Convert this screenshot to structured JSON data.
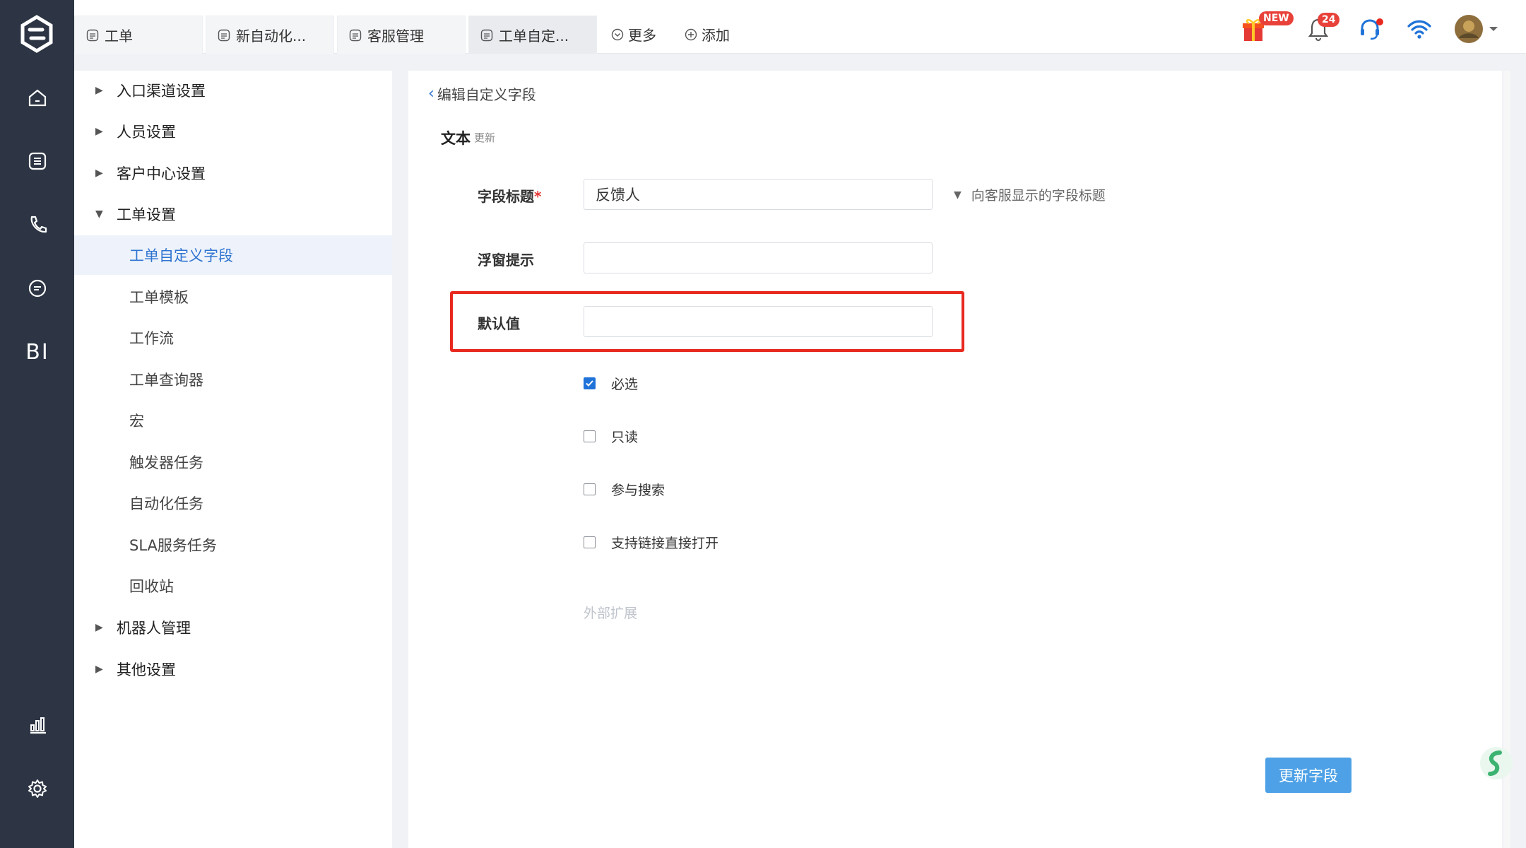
{
  "tabs": [
    {
      "label": "工单"
    },
    {
      "label": "新自动化..."
    },
    {
      "label": "客服管理"
    },
    {
      "label": "工单自定..."
    }
  ],
  "toolbar": {
    "more_label": "更多",
    "add_label": "添加"
  },
  "header": {
    "gift_badge": "NEW",
    "notification_count": "24"
  },
  "rail": {
    "bi_label": "BI"
  },
  "sidebar": {
    "groups": [
      {
        "label": "入口渠道设置"
      },
      {
        "label": "人员设置"
      },
      {
        "label": "客户中心设置"
      },
      {
        "label": "工单设置"
      }
    ],
    "items": [
      {
        "label": "工单自定义字段"
      },
      {
        "label": "工单模板"
      },
      {
        "label": "工作流"
      },
      {
        "label": "工单查询器"
      },
      {
        "label": "宏"
      },
      {
        "label": "触发器任务"
      },
      {
        "label": "自动化任务"
      },
      {
        "label": "SLA服务任务"
      },
      {
        "label": "回收站"
      }
    ],
    "groups_after": [
      {
        "label": "机器人管理"
      },
      {
        "label": "其他设置"
      }
    ]
  },
  "main": {
    "back_label": "编辑自定义字段",
    "section_title": "文本",
    "section_sub": "更新",
    "fields": {
      "title_label": "字段标题",
      "title_required": "*",
      "title_value": "反馈人",
      "title_hint": "向客服显示的字段标题",
      "tooltip_label": "浮窗提示",
      "tooltip_value": "",
      "default_label": "默认值",
      "default_value": ""
    },
    "options": [
      {
        "label": "必选",
        "checked": true
      },
      {
        "label": "只读",
        "checked": false
      },
      {
        "label": "参与搜索",
        "checked": false
      },
      {
        "label": "支持链接直接打开",
        "checked": false
      }
    ],
    "external_label": "外部扩展",
    "submit_label": "更新字段"
  },
  "colors": {
    "accent": "#2f74d0",
    "rail": "#2d3544",
    "highlight": "#e8291f",
    "button": "#4ea1e6"
  }
}
